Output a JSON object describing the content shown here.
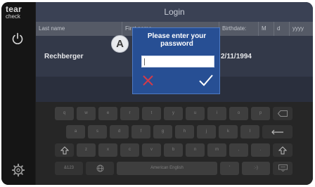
{
  "sidebar": {
    "logo_line1": "tear",
    "logo_line2": "check",
    "power_icon": "power-icon",
    "settings_icon": "gear-icon"
  },
  "screen": {
    "title": "Login",
    "columns": [
      "Last name",
      "First name",
      "Birthdate:",
      "M",
      "d",
      "yyyy"
    ],
    "row": {
      "last_name": "Rechberger",
      "birthdate": "2/11/1994"
    }
  },
  "dialog": {
    "title_line1": "Please enter your",
    "title_line2": "password",
    "password_value": "",
    "cancel_icon": "close-icon",
    "confirm_icon": "checkmark-icon"
  },
  "annotation": {
    "label": "A"
  },
  "keyboard": {
    "row1": [
      "q",
      "w",
      "e",
      "r",
      "t",
      "y",
      "u",
      "i",
      "o",
      "p"
    ],
    "row2": [
      "a",
      "s",
      "d",
      "f",
      "g",
      "h",
      "j",
      "k",
      "l"
    ],
    "row3": [
      "z",
      "x",
      "c",
      "v",
      "b",
      "n",
      "m",
      ",",
      "."
    ],
    "row4": {
      "numbers_label": "&123",
      "space_label": "American English",
      "quote": "'",
      "smiley": ":-)"
    },
    "icons": [
      "backspace-icon",
      "enter-icon",
      "shift-icon",
      "globe-icon",
      "keyboard-hide-icon"
    ]
  },
  "colors": {
    "dialog_bg": "#274f94",
    "cancel_red": "#d23a4a",
    "confirm_white": "#ffffff",
    "title_bar": "#3a4154"
  }
}
